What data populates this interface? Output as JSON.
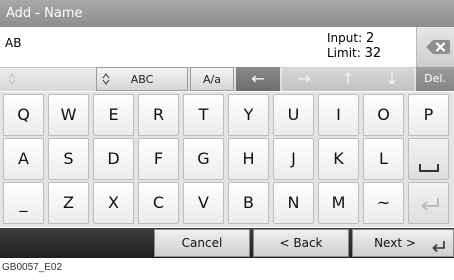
{
  "title": "Add - Name",
  "input": {
    "value": "AB",
    "input_label": "Input:",
    "input_value": "2",
    "limit_label": "Limit:",
    "limit_value": "32"
  },
  "toolbar": {
    "abc_label": "ABC",
    "case_label": "A/a",
    "arrow_left": "←",
    "arrow_right": "→",
    "arrow_up": "↑",
    "arrow_down": "↓",
    "del_label": "Del."
  },
  "keys": {
    "row1": [
      "Q",
      "W",
      "E",
      "R",
      "T",
      "Y",
      "U",
      "I",
      "O",
      "P"
    ],
    "row2": [
      "A",
      "S",
      "D",
      "F",
      "G",
      "H",
      "J",
      "K",
      "L"
    ],
    "row3": [
      "_",
      "Z",
      "X",
      "C",
      "V",
      "B",
      "N",
      "M",
      "~"
    ]
  },
  "nav": {
    "cancel": "Cancel",
    "back": "< Back",
    "next": "Next >"
  },
  "caption": "GB0057_E02",
  "icons": {
    "backspace": "backspace-icon",
    "space": "space-icon",
    "enter": "enter-icon"
  },
  "colors": {
    "title_bar": "#999999",
    "bottom_bar": "#2b2b2b",
    "active_arrow": "#7a7a7a"
  }
}
